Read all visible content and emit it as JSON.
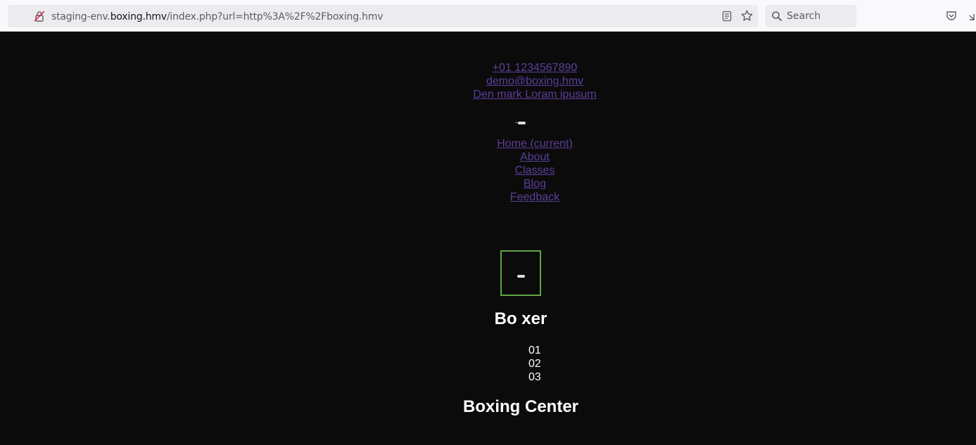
{
  "browser": {
    "url_prefix": "staging-env.",
    "url_host": "boxing.hmv",
    "url_path": "/index.php?url=http%3A%2F%2Fboxing.hmv",
    "search_placeholder": "Search"
  },
  "contact": {
    "phone": " +01 1234567890",
    "email": " demo@boxing.hmv",
    "address": " Den mark Loram ipusum"
  },
  "nav": [
    {
      "label": "Home (current)"
    },
    {
      "label": "About"
    },
    {
      "label": "Classes"
    },
    {
      "label": "Blog"
    },
    {
      "label": "Feedback"
    }
  ],
  "hero": {
    "title": "Bo xer",
    "slides": [
      "01",
      "02",
      "03"
    ]
  },
  "section": {
    "title": "Boxing Center"
  },
  "colors": {
    "page_background": "#0b0b0b",
    "link": "#5b3e9a",
    "frame_border": "#5fa544"
  }
}
